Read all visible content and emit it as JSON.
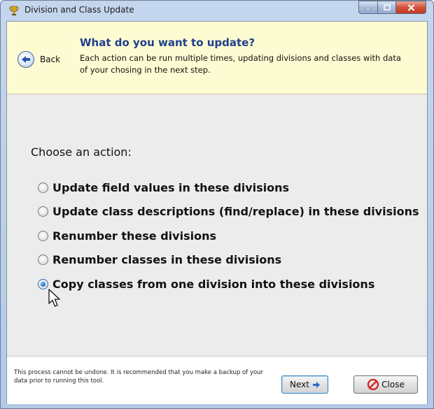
{
  "window": {
    "title": "Division and Class Update",
    "title_bar_color": "#b3c9e6",
    "close_button_color": "#c23a22"
  },
  "header": {
    "back_label": "Back",
    "title": "What do you want to update?",
    "description": "Each action can be run multiple times, updating divisions and classes with data of your chosing in the next step.",
    "background_color": "#fdfbd2",
    "title_color": "#1e3f8c"
  },
  "main": {
    "choose_label": "Choose an action:",
    "options": [
      {
        "label": "Update field values in these divisions",
        "selected": false
      },
      {
        "label": "Update class descriptions (find/replace) in these divisions",
        "selected": false
      },
      {
        "label": "Renumber these divisions",
        "selected": false
      },
      {
        "label": "Renumber classes in these divisions",
        "selected": false
      },
      {
        "label": "Copy classes from one division into these divisions",
        "selected": true
      }
    ]
  },
  "footer": {
    "note": "This process cannot be undone.  It is recommended that you make a backup of your data prior to running this tool.",
    "next_label": "Next",
    "close_label": "Close"
  },
  "icons": {
    "app": "trophy-icon",
    "back": "back-arrow-icon",
    "next": "right-arrow-icon",
    "close": "no-entry-icon",
    "cursor": "mouse-cursor-icon"
  }
}
